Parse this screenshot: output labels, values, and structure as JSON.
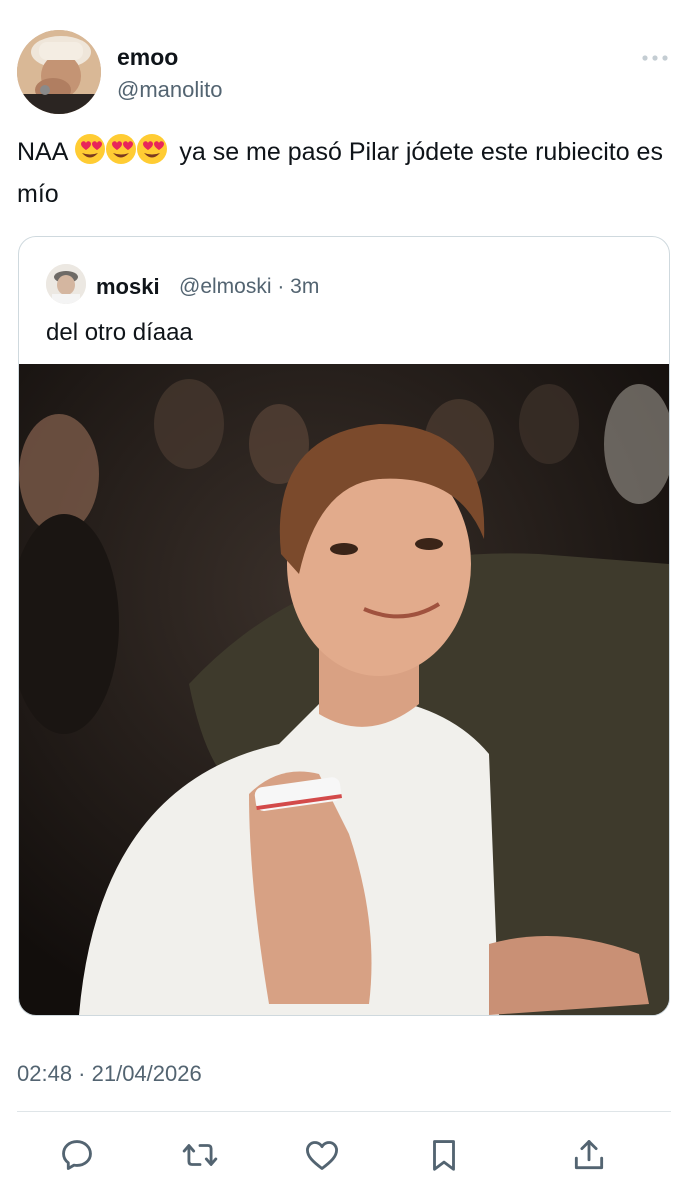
{
  "author": {
    "display_name": "emoo",
    "handle": "@manolito"
  },
  "tweet": {
    "text_before_emoji": "NAA",
    "emoji": [
      "smiling-face-with-heart-eyes",
      "smiling-face-with-heart-eyes",
      "smiling-face-with-heart-eyes"
    ],
    "text_after_emoji": "ya se me pasó Pilar jódete este rubiecito es mío"
  },
  "quoted_tweet": {
    "display_name": "moski",
    "meta": "@elmoski · 3m",
    "text": "del otro díaaa",
    "media": "photo"
  },
  "timestamp": "02:48 · 21/04/2026",
  "actions": [
    "reply-icon",
    "retweet-icon",
    "like-icon",
    "bookmark-icon",
    "share-icon"
  ],
  "colors": {
    "text_primary": "#0f1419",
    "text_secondary": "#536471",
    "border": "#cfd9de",
    "icon": "#536471"
  }
}
